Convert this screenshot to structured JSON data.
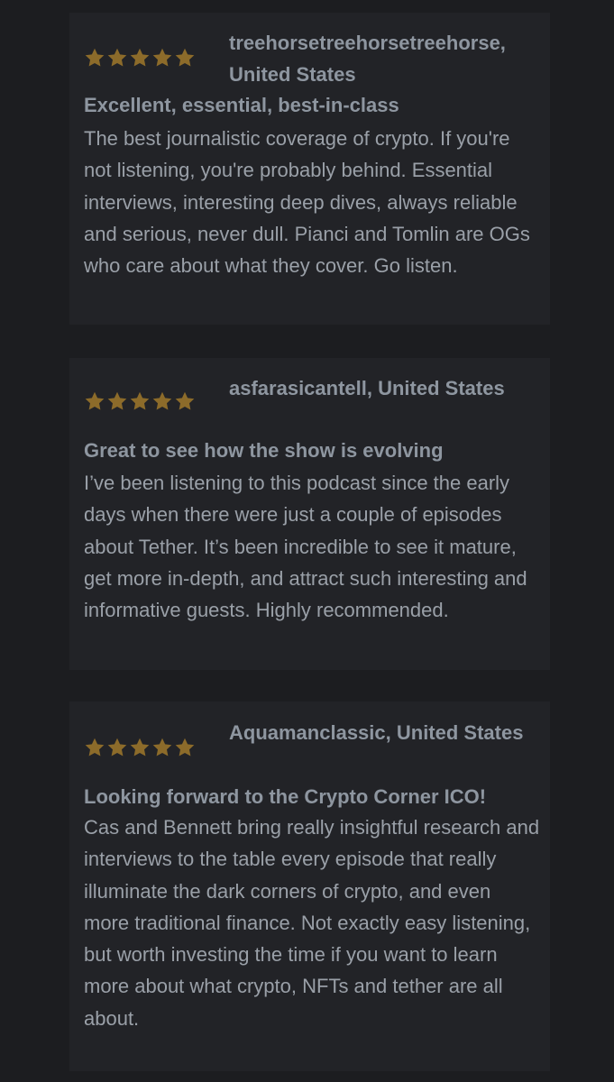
{
  "colors": {
    "background": "#1c1d20",
    "card": "#222327",
    "star": "#8c6b2a",
    "text": "#9aa0a8"
  },
  "reviews": [
    {
      "rating": 5,
      "author": "treehorsetreehorsetreehorse, United States",
      "title": "Excellent, essential, best-in-class",
      "body": "The best journalistic coverage of crypto. If you're not listening, you're probably behind. Essential interviews, interesting deep dives, always reliable and serious, never dull. Pianci and Tomlin are OGs who care about what they cover. Go listen."
    },
    {
      "rating": 5,
      "author": "asfarasicantell, United States",
      "title": "Great to see how the show is evolving",
      "body": "I’ve been listening to this podcast since the early days when there were just a couple of episodes about Tether. It’s been incredible to see it mature, get more in-depth, and attract such interesting and informative guests. Highly recommended."
    },
    {
      "rating": 5,
      "author": "Aquamanclassic, United States",
      "title": "Looking forward to the Crypto Corner ICO!",
      "body": "Cas and Bennett bring really insightful research and interviews to the table every episode that really illuminate the dark corners of crypto, and even more traditional finance. Not exactly easy listening, but worth investing the time if you want to learn more about what crypto, NFTs and tether are all about."
    }
  ]
}
